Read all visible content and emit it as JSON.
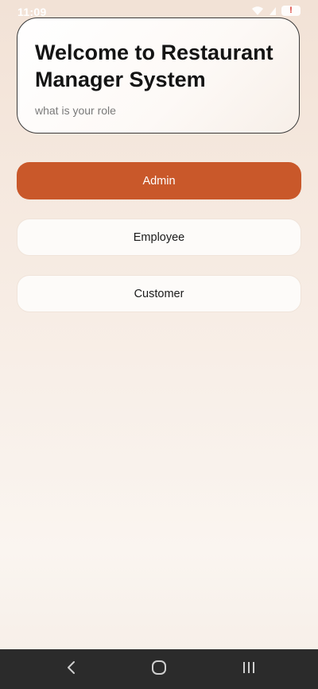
{
  "status_bar": {
    "time": "11:09",
    "icons": [
      "wifi-icon",
      "signal-icon",
      "battery-alert-icon"
    ],
    "battery_alert": "!"
  },
  "welcome": {
    "title": "Welcome to Restaurant Manager System",
    "subtitle": "what is your role"
  },
  "roles": {
    "admin": "Admin",
    "employee": "Employee",
    "customer": "Customer"
  },
  "colors": {
    "accent": "#c9582a",
    "nav_bar": "#2b2b2b"
  },
  "nav_bar": {
    "buttons": [
      "back-icon",
      "home-icon",
      "recents-icon"
    ]
  }
}
